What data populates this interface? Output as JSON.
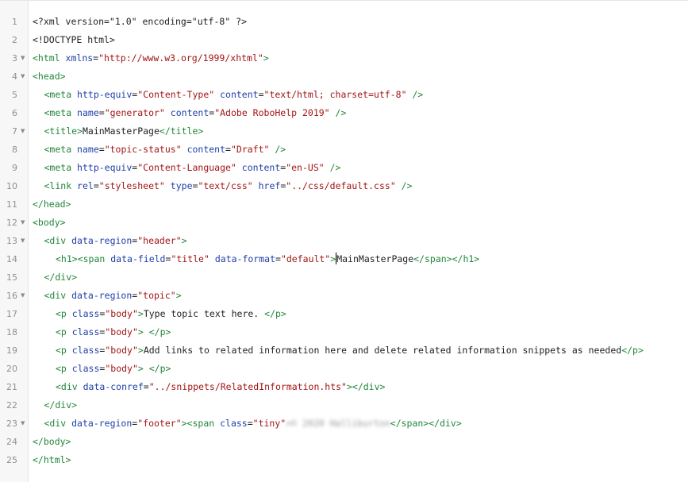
{
  "editor": {
    "lines": [
      {
        "n": "1",
        "indent": 0,
        "fold": false,
        "t": [
          [
            "txt",
            "<?xml version=\"1.0\" encoding=\"utf-8\" ?>"
          ]
        ]
      },
      {
        "n": "2",
        "indent": 0,
        "fold": false,
        "t": [
          [
            "txt",
            "<!DOCTYPE html>"
          ]
        ]
      },
      {
        "n": "3",
        "indent": 0,
        "fold": true,
        "t": [
          [
            "tag",
            "<html "
          ],
          [
            "attr",
            "xmlns"
          ],
          [
            "txt",
            "="
          ],
          [
            "str",
            "\"http://www.w3.org/1999/xhtml\""
          ],
          [
            "tag",
            ">"
          ]
        ]
      },
      {
        "n": "4",
        "indent": 0,
        "fold": true,
        "t": [
          [
            "tag",
            "<head>"
          ]
        ]
      },
      {
        "n": "5",
        "indent": 1,
        "fold": false,
        "t": [
          [
            "tag",
            "<meta "
          ],
          [
            "attr",
            "http-equiv"
          ],
          [
            "txt",
            "="
          ],
          [
            "str",
            "\"Content-Type\""
          ],
          [
            "txt",
            " "
          ],
          [
            "attr",
            "content"
          ],
          [
            "txt",
            "="
          ],
          [
            "str",
            "\"text/html; charset=utf-8\""
          ],
          [
            "tag",
            " />"
          ]
        ]
      },
      {
        "n": "6",
        "indent": 1,
        "fold": false,
        "t": [
          [
            "tag",
            "<meta "
          ],
          [
            "attr",
            "name"
          ],
          [
            "txt",
            "="
          ],
          [
            "str",
            "\"generator\""
          ],
          [
            "txt",
            " "
          ],
          [
            "attr",
            "content"
          ],
          [
            "txt",
            "="
          ],
          [
            "str",
            "\"Adobe RoboHelp 2019\""
          ],
          [
            "tag",
            " />"
          ]
        ]
      },
      {
        "n": "7",
        "indent": 1,
        "fold": true,
        "t": [
          [
            "tag",
            "<title>"
          ],
          [
            "txt",
            "MainMasterPage"
          ],
          [
            "tag",
            "</title>"
          ]
        ]
      },
      {
        "n": "8",
        "indent": 1,
        "fold": false,
        "t": [
          [
            "tag",
            "<meta "
          ],
          [
            "attr",
            "name"
          ],
          [
            "txt",
            "="
          ],
          [
            "str",
            "\"topic-status\""
          ],
          [
            "txt",
            " "
          ],
          [
            "attr",
            "content"
          ],
          [
            "txt",
            "="
          ],
          [
            "str",
            "\"Draft\""
          ],
          [
            "tag",
            " />"
          ]
        ]
      },
      {
        "n": "9",
        "indent": 1,
        "fold": false,
        "t": [
          [
            "tag",
            "<meta "
          ],
          [
            "attr",
            "http-equiv"
          ],
          [
            "txt",
            "="
          ],
          [
            "str",
            "\"Content-Language\""
          ],
          [
            "txt",
            " "
          ],
          [
            "attr",
            "content"
          ],
          [
            "txt",
            "="
          ],
          [
            "str",
            "\"en-US\""
          ],
          [
            "tag",
            " />"
          ]
        ]
      },
      {
        "n": "10",
        "indent": 1,
        "fold": false,
        "t": [
          [
            "tag",
            "<link "
          ],
          [
            "attr",
            "rel"
          ],
          [
            "txt",
            "="
          ],
          [
            "str",
            "\"stylesheet\""
          ],
          [
            "txt",
            " "
          ],
          [
            "attr",
            "type"
          ],
          [
            "txt",
            "="
          ],
          [
            "str",
            "\"text/css\""
          ],
          [
            "txt",
            " "
          ],
          [
            "attr",
            "href"
          ],
          [
            "txt",
            "="
          ],
          [
            "str",
            "\"../css/default.css\""
          ],
          [
            "tag",
            " />"
          ]
        ]
      },
      {
        "n": "11",
        "indent": 0,
        "fold": false,
        "t": [
          [
            "tag",
            "</head>"
          ]
        ]
      },
      {
        "n": "12",
        "indent": 0,
        "fold": true,
        "t": [
          [
            "tag",
            "<body>"
          ]
        ]
      },
      {
        "n": "13",
        "indent": 1,
        "fold": true,
        "t": [
          [
            "tag",
            "<div "
          ],
          [
            "attr",
            "data-region"
          ],
          [
            "txt",
            "="
          ],
          [
            "str",
            "\"header\""
          ],
          [
            "tag",
            ">"
          ]
        ]
      },
      {
        "n": "14",
        "indent": 2,
        "fold": false,
        "t": [
          [
            "tag",
            "<h1><span "
          ],
          [
            "attr",
            "data-field"
          ],
          [
            "txt",
            "="
          ],
          [
            "str",
            "\"title\""
          ],
          [
            "txt",
            " "
          ],
          [
            "attr",
            "data-format"
          ],
          [
            "txt",
            "="
          ],
          [
            "str",
            "\"default\""
          ],
          [
            "tag",
            ">"
          ],
          [
            "caret",
            ""
          ],
          [
            "txt",
            "MainMasterPage"
          ],
          [
            "tag",
            "</span></h1>"
          ]
        ]
      },
      {
        "n": "15",
        "indent": 1,
        "fold": false,
        "t": [
          [
            "tag",
            "</div>"
          ]
        ]
      },
      {
        "n": "16",
        "indent": 1,
        "fold": true,
        "t": [
          [
            "tag",
            "<div "
          ],
          [
            "attr",
            "data-region"
          ],
          [
            "txt",
            "="
          ],
          [
            "str",
            "\"topic\""
          ],
          [
            "tag",
            ">"
          ]
        ]
      },
      {
        "n": "17",
        "indent": 2,
        "fold": false,
        "t": [
          [
            "tag",
            "<p "
          ],
          [
            "attr",
            "class"
          ],
          [
            "txt",
            "="
          ],
          [
            "str",
            "\"body\""
          ],
          [
            "tag",
            ">"
          ],
          [
            "txt",
            "Type topic text here. "
          ],
          [
            "tag",
            "</p>"
          ]
        ]
      },
      {
        "n": "18",
        "indent": 2,
        "fold": false,
        "t": [
          [
            "tag",
            "<p "
          ],
          [
            "attr",
            "class"
          ],
          [
            "txt",
            "="
          ],
          [
            "str",
            "\"body\""
          ],
          [
            "tag",
            "> </p>"
          ]
        ]
      },
      {
        "n": "19",
        "indent": 2,
        "fold": false,
        "t": [
          [
            "tag",
            "<p "
          ],
          [
            "attr",
            "class"
          ],
          [
            "txt",
            "="
          ],
          [
            "str",
            "\"body\""
          ],
          [
            "tag",
            ">"
          ],
          [
            "txt",
            "Add links to related information here and delete related information snippets as needed"
          ],
          [
            "tag",
            "</p>"
          ]
        ]
      },
      {
        "n": "20",
        "indent": 2,
        "fold": false,
        "t": [
          [
            "tag",
            "<p "
          ],
          [
            "attr",
            "class"
          ],
          [
            "txt",
            "="
          ],
          [
            "str",
            "\"body\""
          ],
          [
            "tag",
            "> </p>"
          ]
        ]
      },
      {
        "n": "21",
        "indent": 2,
        "fold": false,
        "t": [
          [
            "tag",
            "<div "
          ],
          [
            "attr",
            "data-conref"
          ],
          [
            "txt",
            "="
          ],
          [
            "str",
            "\"../snippets/RelatedInformation.hts\""
          ],
          [
            "tag",
            "></div>"
          ]
        ]
      },
      {
        "n": "22",
        "indent": 1,
        "fold": false,
        "t": [
          [
            "tag",
            "</div>"
          ]
        ]
      },
      {
        "n": "23",
        "indent": 1,
        "fold": true,
        "t": [
          [
            "tag",
            "<div "
          ],
          [
            "attr",
            "data-region"
          ],
          [
            "txt",
            "="
          ],
          [
            "str",
            "\"footer\""
          ],
          [
            "tag",
            "><span "
          ],
          [
            "attr",
            "class"
          ],
          [
            "txt",
            "="
          ],
          [
            "str",
            "\"tiny\""
          ],
          [
            "blur",
            ">© 2020 Halliburton"
          ],
          [
            "tag",
            "</span></div>"
          ]
        ]
      },
      {
        "n": "24",
        "indent": 0,
        "fold": false,
        "t": [
          [
            "tag",
            "</body>"
          ]
        ]
      },
      {
        "n": "25",
        "indent": 0,
        "fold": false,
        "t": [
          [
            "tag",
            "</html>"
          ]
        ]
      }
    ]
  },
  "colors": {
    "tag": "#22863a",
    "attribute": "#1f3fa8",
    "string": "#a31515",
    "text": "#222222",
    "gutter_bg": "#f7f7f7"
  },
  "icons": {
    "fold": "caret-down-icon"
  }
}
